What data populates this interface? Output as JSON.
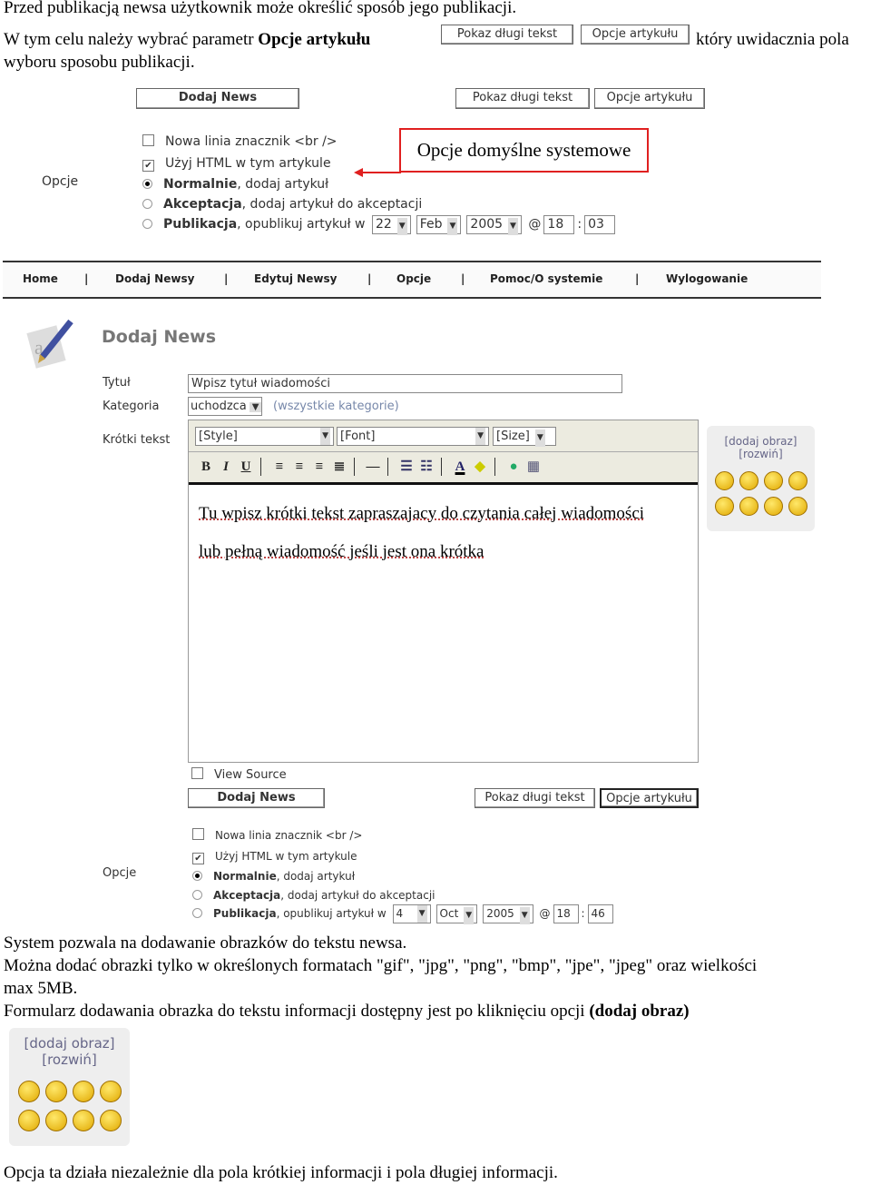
{
  "doc": {
    "p1": "Przed publikacją newsa użytkownik może określić sposób jego publikacji.",
    "p2a": "W tym celu należy wybrać  parametr ",
    "p2b": "Opcje artykułu",
    "p2c": "który uwidacznia pola",
    "p3": "wyboru sposobu publikacji.",
    "p4": "System pozwala na dodawanie obrazków do tekstu newsa.",
    "p5": "Można dodać obrazki tylko w określonych formatach \"gif\", \"jpg\", \"png\", \"bmp\", \"jpe\", \"jpeg\" oraz wielkości",
    "p6": "max 5MB.",
    "p7a": "Formularz dodawania obrazka do tekstu informacji dostępny jest po kliknięciu opcji ",
    "p7b": "(dodaj obraz)",
    "p8": "Opcja ta działa niezależnie dla pola krótkiej informacji i pola długiej informacji."
  },
  "buttons": {
    "add": "Dodaj News",
    "show_long": "Pokaz długi tekst",
    "options": "Opcje artykułu"
  },
  "callout": {
    "text": "Opcje domyślne systemowe",
    "color": "#e02020"
  },
  "opts1": {
    "label": "Opcje",
    "newline": "Nowa linia znacznik <br />",
    "html": "Użyj HTML w tym artykule",
    "normal_b": "Normalnie",
    "normal": ", dodaj artykuł",
    "accept_b": "Akceptacja",
    "accept": ", dodaj artykuł do akceptacji",
    "pub_b": "Publikacja",
    "pub": ", opublikuj artykuł w",
    "day": "22",
    "month": "Feb",
    "year": "2005",
    "at": "@",
    "hour": "18",
    "colon": ":",
    "min": "03"
  },
  "nav": [
    "Home",
    "Dodaj Newsy",
    "Edytuj Newsy",
    "Opcje",
    "Pomoc/O systemie",
    "Wylogowanie"
  ],
  "form": {
    "title": "Dodaj News",
    "title_label": "Tytuł",
    "title_value": "Wpisz tytuł  wiadomości",
    "cat_label": "Kategoria",
    "cat_value": "uchodzca",
    "cat_link": "(wszystkie kategorie)",
    "short_label": "Krótki tekst",
    "style": "[Style]",
    "font": "[Font]",
    "size": "[Size]",
    "line1": "Tu wpisz krótki tekst zapraszajacy do czytania całej wiadomości",
    "line2": "lub pełną wiadomość jeśli jest ona krótka",
    "view_source": "View Source"
  },
  "panel": {
    "add_image": "[dodaj obraz]",
    "expand": "[rozwiń]"
  },
  "opts2": {
    "label": "Opcje",
    "newline": "Nowa linia znacznik <br />",
    "html": "Użyj HTML w tym artykule",
    "normal_b": "Normalnie",
    "normal": ", dodaj artykuł",
    "accept_b": "Akceptacja",
    "accept": ", dodaj artykuł do akceptacji",
    "pub_b": "Publikacja",
    "pub": ", opublikuj artykuł w",
    "day": "4",
    "month": "Oct",
    "year": "2005",
    "at": "@",
    "hour": "18",
    "colon": ":",
    "min": "46"
  }
}
